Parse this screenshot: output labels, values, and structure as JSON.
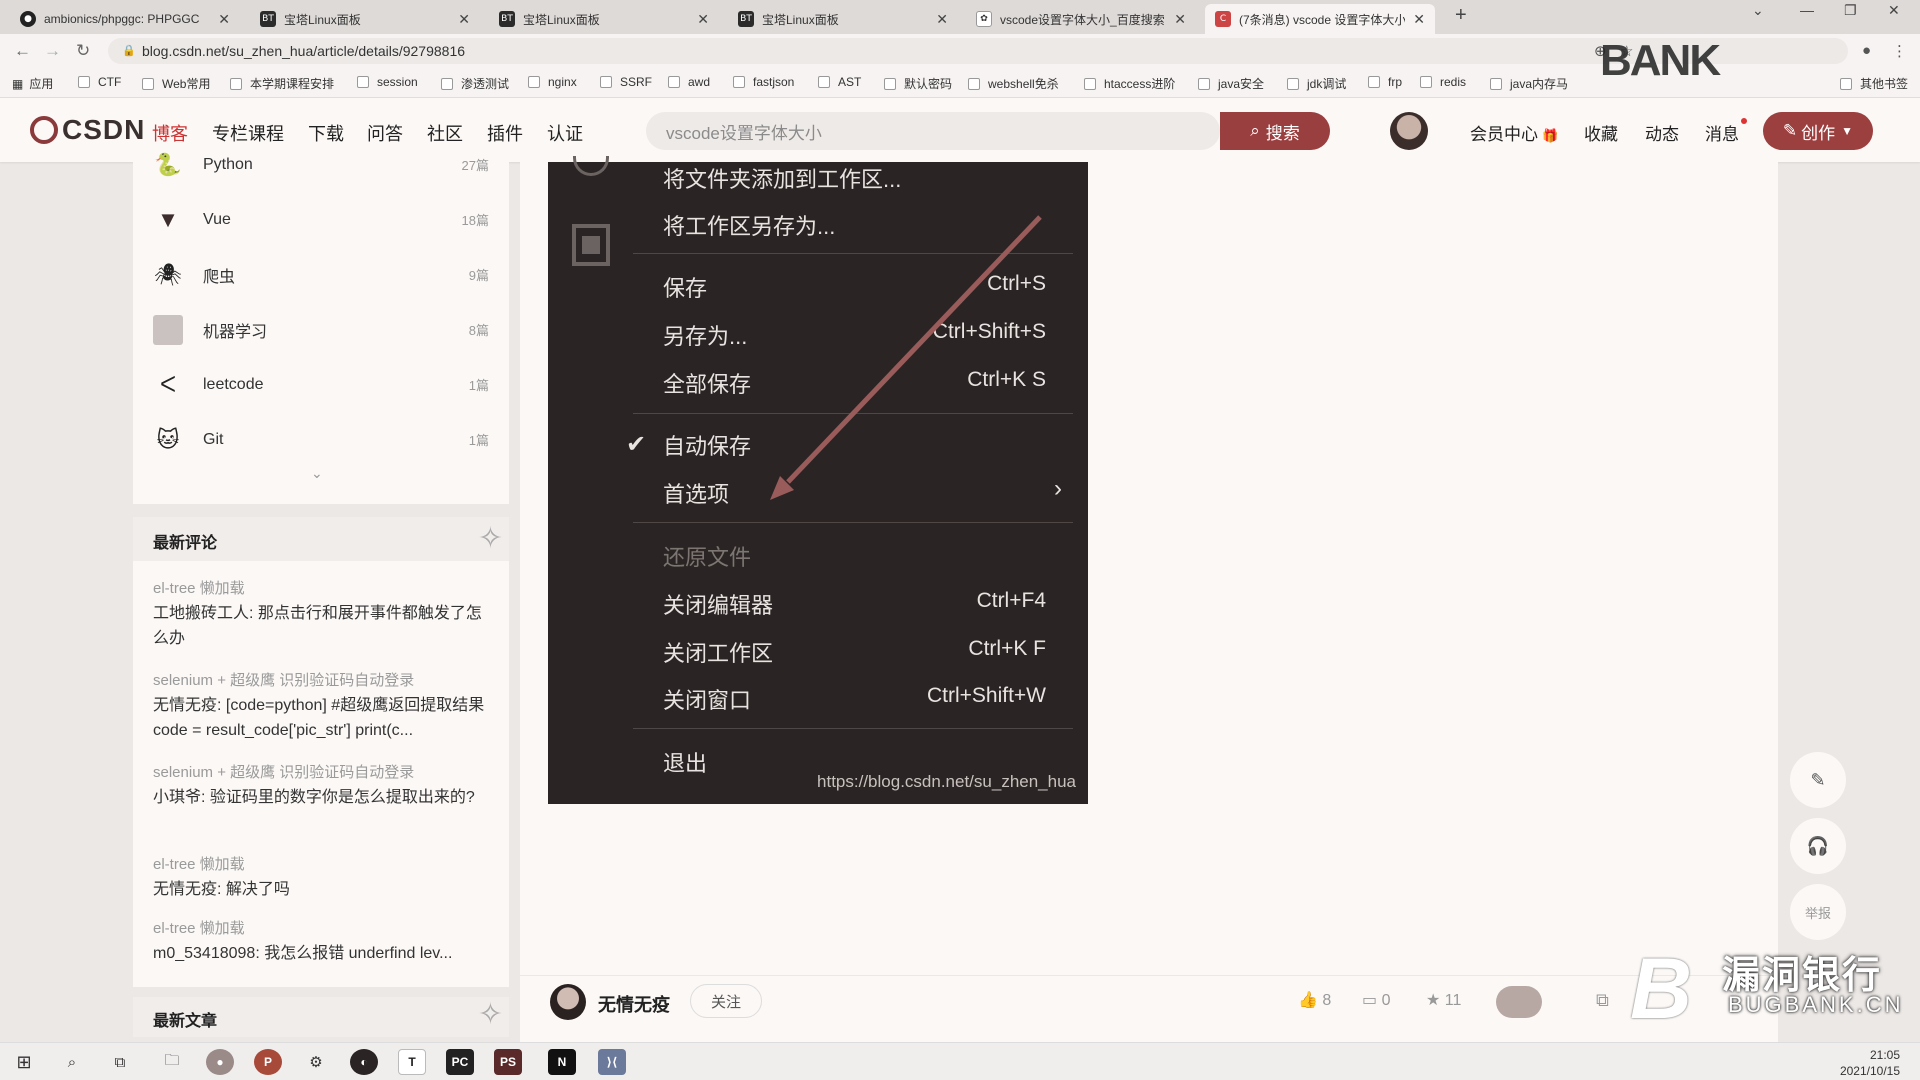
{
  "browser": {
    "tabs": [
      {
        "icon": "github-icon",
        "title": "ambionics/phpggc: PHPGGC"
      },
      {
        "icon": "bt-icon",
        "title": "宝塔Linux面板"
      },
      {
        "icon": "bt-icon",
        "title": "宝塔Linux面板"
      },
      {
        "icon": "bt-icon",
        "title": "宝塔Linux面板"
      },
      {
        "icon": "baidu-icon",
        "title": "vscode设置字体大小_百度搜索"
      },
      {
        "icon": "csdn-icon",
        "title": "(7条消息) vscode 设置字体大小"
      }
    ],
    "url": "blog.csdn.net/su_zhen_hua/article/details/92798816",
    "bookmarks": [
      "应用",
      "CTF",
      "Web常用",
      "本学期课程安排",
      "session",
      "渗透测试",
      "nginx",
      "SSRF",
      "awd",
      "fastjson",
      "AST",
      "默认密码",
      "webshell免杀",
      "htaccess进阶",
      "java安全",
      "jdk调试",
      "frp",
      "redis",
      "java内存马",
      "其他书签"
    ]
  },
  "csdn": {
    "logo": "CSDN",
    "nav": [
      "博客",
      "专栏课程",
      "下载",
      "问答",
      "社区",
      "插件",
      "认证"
    ],
    "search_placeholder": "vscode设置字体大小",
    "search_button": "搜索",
    "links": [
      "会员中心",
      "收藏",
      "动态",
      "消息"
    ],
    "create_button": "创作"
  },
  "sidebar": {
    "categories": [
      {
        "icon": "python-icon",
        "name": "Python",
        "count": "27篇"
      },
      {
        "icon": "vue-icon",
        "name": "Vue",
        "count": "18篇"
      },
      {
        "icon": "spider-icon",
        "name": "爬虫",
        "count": "9篇"
      },
      {
        "icon": "ml-icon",
        "name": "机器学习",
        "count": "8篇"
      },
      {
        "icon": "leetcode-icon",
        "name": "leetcode",
        "count": "1篇"
      },
      {
        "icon": "git-icon",
        "name": "Git",
        "count": "1篇"
      }
    ],
    "latest_comments_title": "最新评论",
    "comments": [
      {
        "article": "el-tree 懒加载",
        "text": "工地搬砖工人: 那点击行和展开事件都触发了怎么办"
      },
      {
        "article": "selenium + 超级鹰 识别验证码自动登录",
        "text": "无情无疫: [code=python] #超级鹰返回提取结果 code = result_code['pic_str'] print(c..."
      },
      {
        "article": "selenium + 超级鹰 识别验证码自动登录",
        "text": "小琪爷: 验证码里的数字你是怎么提取出来的?"
      },
      {
        "article": "el-tree 懒加载",
        "text": "无情无疫: 解决了吗"
      },
      {
        "article": "el-tree 懒加载",
        "text": "m0_53418098: 我怎么报错 underfind lev..."
      }
    ],
    "latest_articles_title": "最新文章"
  },
  "menu": {
    "items": [
      {
        "label": "将文件夹添加到工作区...",
        "shortcut": ""
      },
      {
        "label": "将工作区另存为...",
        "shortcut": ""
      },
      {
        "label": "保存",
        "shortcut": "Ctrl+S"
      },
      {
        "label": "另存为...",
        "shortcut": "Ctrl+Shift+S"
      },
      {
        "label": "全部保存",
        "shortcut": "Ctrl+K S"
      },
      {
        "label": "自动保存",
        "shortcut": ""
      },
      {
        "label": "首选项",
        "shortcut": ""
      },
      {
        "label": "还原文件",
        "shortcut": ""
      },
      {
        "label": "关闭编辑器",
        "shortcut": "Ctrl+F4"
      },
      {
        "label": "关闭工作区",
        "shortcut": "Ctrl+K F"
      },
      {
        "label": "关闭窗口",
        "shortcut": "Ctrl+Shift+W"
      },
      {
        "label": "退出",
        "shortcut": ""
      }
    ],
    "watermark_url": "https://blog.csdn.net/su_zhen_hua"
  },
  "float_buttons": {
    "report_label": "举报"
  },
  "author": {
    "name": "无情无疫",
    "follow": "关注",
    "likes": "8",
    "comments": "0",
    "stars": "11"
  },
  "taskbar": {
    "time": "21:05",
    "date": "2021/10/15"
  },
  "watermarks": {
    "top": "BANK",
    "bottom_big": "漏洞银行",
    "bottom_small": "BUGBANK.CN"
  },
  "colors": {
    "accent": "#9a3f3f",
    "menu_bg": "#2a2524"
  }
}
